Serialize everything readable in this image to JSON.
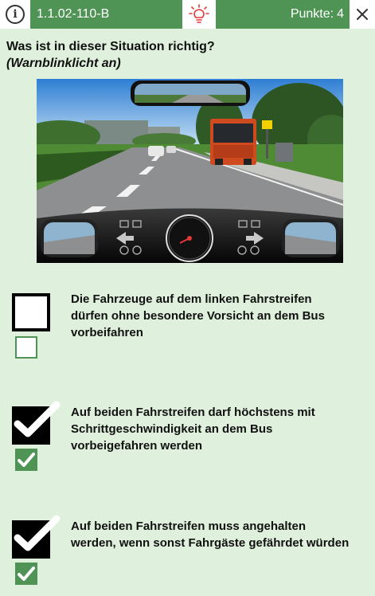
{
  "header": {
    "info_icon": "info-icon",
    "question_id": "1.1.02-110-B",
    "hint_icon": "lightbulb-icon",
    "points_label": "Punkte:",
    "points_value": "4",
    "close_icon": "close-icon",
    "accent_color": "#4f9455",
    "hint_color": "#e53935"
  },
  "question": {
    "title": "Was ist in dieser Situation richtig?",
    "subtitle": "(Warnblinklicht an)"
  },
  "scene": {
    "speedometer_unit": "km/h",
    "speed_ticks": [
      "20",
      "40",
      "60",
      "80",
      "100",
      "120",
      "140",
      "160"
    ]
  },
  "answers": [
    {
      "text": "Die Fahrzeuge auf dem linken Fahrstreifen dürfen ohne besondere Vorsicht an dem Bus vorbeifahren",
      "user_checked": false,
      "solution_checked": false
    },
    {
      "text": "Auf beiden Fahrstreifen darf höchstens mit Schrittgeschwindigkeit an dem Bus vorbeigefahren werden",
      "user_checked": true,
      "solution_checked": true
    },
    {
      "text": "Auf beiden Fahrstreifen muss angehalten werden, wenn sonst Fahrgäste gefährdet würden",
      "user_checked": true,
      "solution_checked": true
    }
  ]
}
